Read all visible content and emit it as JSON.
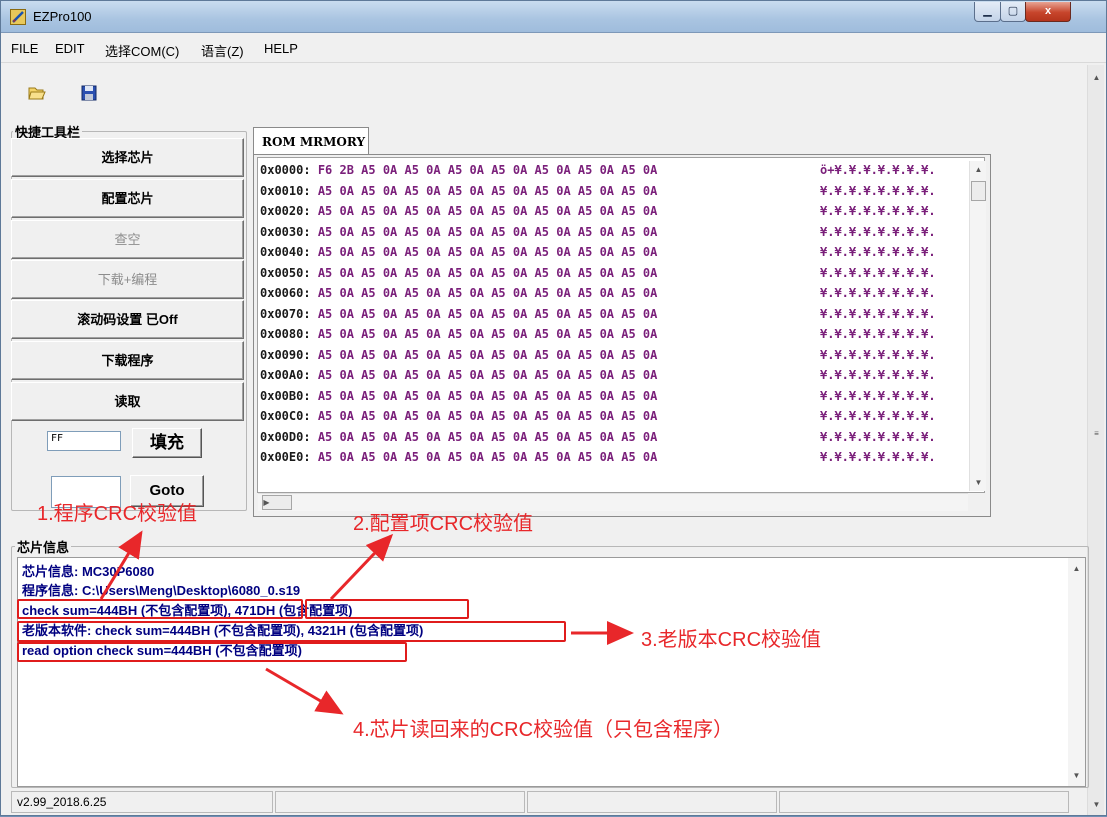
{
  "window": {
    "title": "EZPro100",
    "min_glyph": "▁",
    "max_glyph": "▢",
    "close_glyph": "x"
  },
  "menu": {
    "file": "FILE",
    "edit": "EDIT",
    "com": "选择COM(C)",
    "lang": "语言(Z)",
    "help": "HELP"
  },
  "toolbar": {
    "open_icon": "folder-open-icon",
    "save_icon": "floppy-save-icon"
  },
  "quick_tools": {
    "legend": "快捷工具栏",
    "buttons": [
      "选择芯片",
      "配置芯片",
      "查空",
      "下载+编程",
      "滚动码设置 已Off",
      "下载程序",
      "读取"
    ],
    "disabled": [
      false,
      false,
      true,
      true,
      false,
      false,
      false
    ],
    "fill_value": "FF",
    "fill_button": "填充",
    "goto_value": "",
    "goto_button": "Goto"
  },
  "rom": {
    "tab_label": "ROM MRMORY",
    "rows": [
      {
        "addr": "0x0000:",
        "bytes": "F6 2B A5 0A A5 0A A5 0A A5 0A A5 0A A5 0A A5 0A",
        "ascii": "ö+¥.¥.¥.¥.¥.¥.¥."
      },
      {
        "addr": "0x0010:",
        "bytes": "A5 0A A5 0A A5 0A A5 0A A5 0A A5 0A A5 0A A5 0A",
        "ascii": "¥.¥.¥.¥.¥.¥.¥.¥."
      },
      {
        "addr": "0x0020:",
        "bytes": "A5 0A A5 0A A5 0A A5 0A A5 0A A5 0A A5 0A A5 0A",
        "ascii": "¥.¥.¥.¥.¥.¥.¥.¥."
      },
      {
        "addr": "0x0030:",
        "bytes": "A5 0A A5 0A A5 0A A5 0A A5 0A A5 0A A5 0A A5 0A",
        "ascii": "¥.¥.¥.¥.¥.¥.¥.¥."
      },
      {
        "addr": "0x0040:",
        "bytes": "A5 0A A5 0A A5 0A A5 0A A5 0A A5 0A A5 0A A5 0A",
        "ascii": "¥.¥.¥.¥.¥.¥.¥.¥."
      },
      {
        "addr": "0x0050:",
        "bytes": "A5 0A A5 0A A5 0A A5 0A A5 0A A5 0A A5 0A A5 0A",
        "ascii": "¥.¥.¥.¥.¥.¥.¥.¥."
      },
      {
        "addr": "0x0060:",
        "bytes": "A5 0A A5 0A A5 0A A5 0A A5 0A A5 0A A5 0A A5 0A",
        "ascii": "¥.¥.¥.¥.¥.¥.¥.¥."
      },
      {
        "addr": "0x0070:",
        "bytes": "A5 0A A5 0A A5 0A A5 0A A5 0A A5 0A A5 0A A5 0A",
        "ascii": "¥.¥.¥.¥.¥.¥.¥.¥."
      },
      {
        "addr": "0x0080:",
        "bytes": "A5 0A A5 0A A5 0A A5 0A A5 0A A5 0A A5 0A A5 0A",
        "ascii": "¥.¥.¥.¥.¥.¥.¥.¥."
      },
      {
        "addr": "0x0090:",
        "bytes": "A5 0A A5 0A A5 0A A5 0A A5 0A A5 0A A5 0A A5 0A",
        "ascii": "¥.¥.¥.¥.¥.¥.¥.¥."
      },
      {
        "addr": "0x00A0:",
        "bytes": "A5 0A A5 0A A5 0A A5 0A A5 0A A5 0A A5 0A A5 0A",
        "ascii": "¥.¥.¥.¥.¥.¥.¥.¥."
      },
      {
        "addr": "0x00B0:",
        "bytes": "A5 0A A5 0A A5 0A A5 0A A5 0A A5 0A A5 0A A5 0A",
        "ascii": "¥.¥.¥.¥.¥.¥.¥.¥."
      },
      {
        "addr": "0x00C0:",
        "bytes": "A5 0A A5 0A A5 0A A5 0A A5 0A A5 0A A5 0A A5 0A",
        "ascii": "¥.¥.¥.¥.¥.¥.¥.¥."
      },
      {
        "addr": "0x00D0:",
        "bytes": "A5 0A A5 0A A5 0A A5 0A A5 0A A5 0A A5 0A A5 0A",
        "ascii": "¥.¥.¥.¥.¥.¥.¥.¥."
      },
      {
        "addr": "0x00E0:",
        "bytes": "A5 0A A5 0A A5 0A A5 0A A5 0A A5 0A A5 0A A5 0A",
        "ascii": "¥.¥.¥.¥.¥.¥.¥.¥."
      }
    ]
  },
  "chip_info": {
    "legend": "芯片信息",
    "lines": [
      "芯片信息: MC30P6080",
      "程序信息: C:\\Users\\Meng\\Desktop\\6080_0.s19",
      "check sum=444BH (不包含配置项), 471DH (包含配置项)",
      "老版本软件: check sum=444BH (不包含配置项), 4321H (包含配置项)",
      "read option check sum=444BH (不包含配置项)"
    ]
  },
  "status": {
    "version": "v2.99_2018.6.25",
    "cell2": "",
    "cell3": "",
    "cell4": ""
  },
  "annotations": {
    "a1": "1.程序CRC校验值",
    "a2": "2.配置项CRC校验值",
    "a3": "3.老版本CRC校验值",
    "a4": "4.芯片读回来的CRC校验值（只包含程序）",
    "color": "#e8272a"
  }
}
